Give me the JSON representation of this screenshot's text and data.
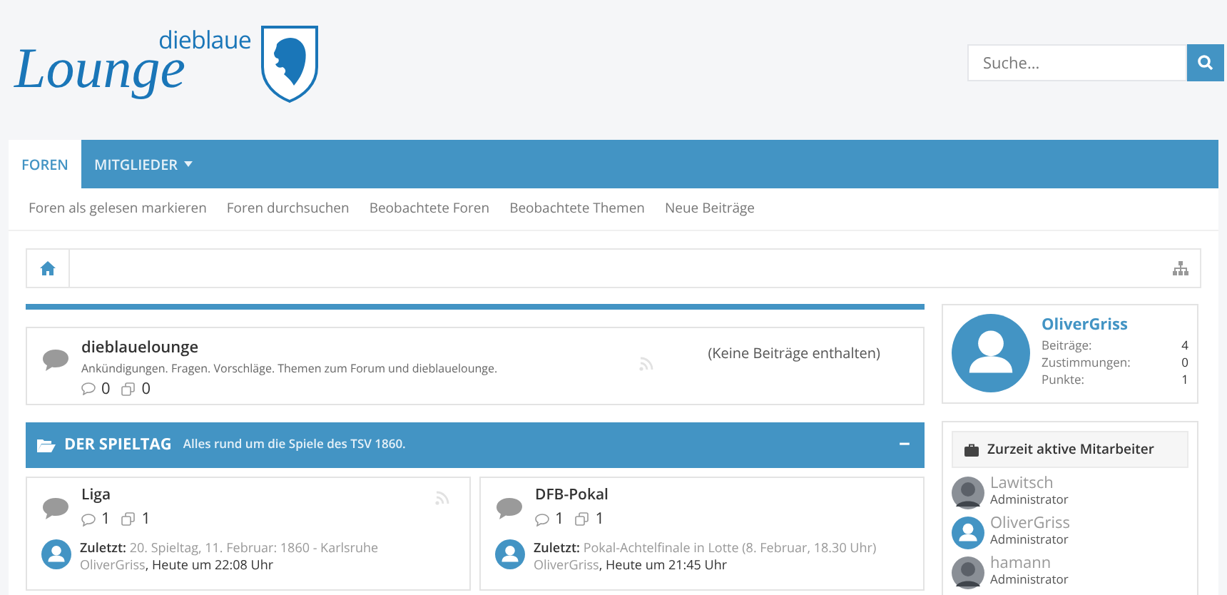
{
  "logo": {
    "small": "dieblaue",
    "script": "Lounge"
  },
  "search": {
    "placeholder": "Suche..."
  },
  "nav": {
    "tabs": [
      {
        "label": "FOREN",
        "selected": true,
        "dropdown": false
      },
      {
        "label": "MITGLIEDER",
        "selected": false,
        "dropdown": true
      }
    ],
    "subnav": [
      "Foren als gelesen markieren",
      "Foren durchsuchen",
      "Beobachtete Foren",
      "Beobachtete Themen",
      "Neue Beiträge"
    ]
  },
  "top_forum": {
    "title": "dieblauelounge",
    "description": "Ankündigungen. Fragen. Vorschläge. Themen zum Forum und dieblauelounge.",
    "threads": "0",
    "posts": "0",
    "last": "(Keine Beiträge enthalten)"
  },
  "category": {
    "title": "DER SPIELTAG",
    "description": "Alles rund um die Spiele des TSV 1860.",
    "collapse": "−",
    "forums": [
      {
        "title": "Liga",
        "threads": "1",
        "posts": "1",
        "last_label": "Zuletzt:",
        "last_title": "20. Spieltag, 11. Februar: 1860 - Karlsruhe",
        "last_user": "OliverGriss",
        "last_time": ", Heute um 22:08 Uhr"
      },
      {
        "title": "DFB-Pokal",
        "threads": "1",
        "posts": "1",
        "last_label": "Zuletzt:",
        "last_title": "Pokal-Achtelfinale in Lotte (8. Februar, 18.30 Uhr)",
        "last_user": "OliverGriss",
        "last_time": ", Heute um 21:45 Uhr"
      }
    ]
  },
  "profile": {
    "name": "OliverGriss",
    "stats": [
      {
        "label": "Beiträge:",
        "value": "4"
      },
      {
        "label": "Zustimmungen:",
        "value": "0"
      },
      {
        "label": "Punkte:",
        "value": "1"
      }
    ]
  },
  "staff": {
    "title": "Zurzeit aktive Mitarbeiter",
    "members": [
      {
        "name": "Lawitsch",
        "role": "Administrator"
      },
      {
        "name": "OliverGriss",
        "role": "Administrator",
        "kind": "default"
      },
      {
        "name": "hamann",
        "role": "Administrator"
      }
    ]
  }
}
